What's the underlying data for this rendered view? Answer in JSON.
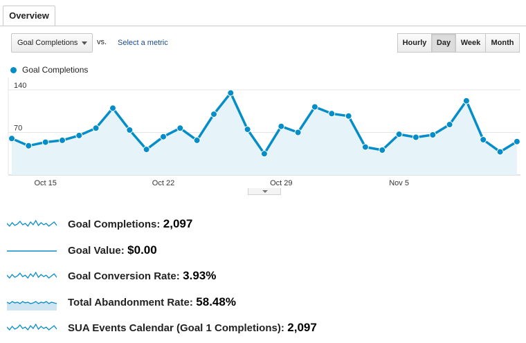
{
  "tabs": {
    "overview": "Overview"
  },
  "controls": {
    "metric_select": "Goal Completions",
    "vs": "vs.",
    "select_metric": "Select a metric",
    "granularity": [
      "Hourly",
      "Day",
      "Week",
      "Month"
    ],
    "selected_granularity": "Day"
  },
  "legend": {
    "series": "Goal Completions",
    "color": "#058dc7"
  },
  "chart_data": {
    "type": "area",
    "title": "",
    "x_tick_labels": [
      "Oct 15",
      "Oct 22",
      "Oct 29",
      "Nov 5"
    ],
    "y_tick_labels": [
      "140",
      "70"
    ],
    "ylim": [
      0,
      140
    ],
    "grid": true,
    "series": [
      {
        "name": "Goal Completions",
        "color": "#058dc7",
        "values": [
          60,
          48,
          54,
          57,
          65,
          77,
          110,
          74,
          42,
          63,
          77,
          57,
          100,
          135,
          75,
          35,
          80,
          70,
          112,
          101,
          97,
          46,
          41,
          67,
          62,
          66,
          83,
          122,
          58,
          38,
          55
        ]
      }
    ]
  },
  "summary_metrics": [
    {
      "label": "Goal Completions:",
      "value": "2,097",
      "spark": "wavy"
    },
    {
      "label": "Goal Value:",
      "value": "$0.00",
      "spark": "flat"
    },
    {
      "label": "Goal Conversion Rate:",
      "value": "3.93%",
      "spark": "wavy"
    },
    {
      "label": "Total Abandonment Rate:",
      "value": "58.48%",
      "spark": "filled"
    },
    {
      "label": "SUA Events Calendar (Goal 1 Completions):",
      "value": "2,097",
      "spark": "wavy"
    }
  ]
}
